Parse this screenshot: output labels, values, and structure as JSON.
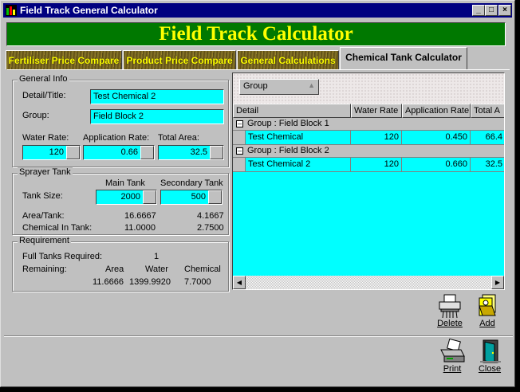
{
  "window": {
    "title": "Field Track General Calculator",
    "minimize": "_",
    "maximize": "□",
    "close": "×"
  },
  "banner": "Field Track Calculator",
  "tabs": [
    "Fertiliser Price Compare",
    "Product Price Compare",
    "General Calculations",
    "Chemical Tank Calculator"
  ],
  "general_info": {
    "title": "General Info",
    "detail_label": "Detail/Title:",
    "detail_value": "Test Chemical 2",
    "group_label": "Group:",
    "group_value": "Field Block 2",
    "water_rate_label": "Water Rate:",
    "water_rate_value": "120",
    "app_rate_label": "Application Rate:",
    "app_rate_value": "0.66",
    "total_area_label": "Total Area:",
    "total_area_value": "32.5"
  },
  "sprayer_tank": {
    "title": "Sprayer Tank",
    "main_tank_label": "Main Tank",
    "secondary_tank_label": "Secondary Tank",
    "tank_size_label": "Tank Size:",
    "main_size": "2000",
    "secondary_size": "500",
    "area_tank_label": "Area/Tank:",
    "area_main": "16.6667",
    "area_secondary": "4.1667",
    "chem_tank_label": "Chemical In Tank:",
    "chem_main": "11.0000",
    "chem_secondary": "2.7500"
  },
  "requirement": {
    "title": "Requirement",
    "full_tanks_label": "Full Tanks Required:",
    "full_tanks_value": "1",
    "remaining_label": "Remaining:",
    "col_area": "Area",
    "col_water": "Water",
    "col_chemical": "Chemical",
    "area_value": "11.6666",
    "water_value": "1399.9920",
    "chemical_value": "7.7000"
  },
  "grid": {
    "group_button": "Group",
    "columns": [
      "Detail",
      "Water Rate",
      "Application Rate",
      "Total A"
    ],
    "groups": [
      {
        "label": "Group : Field Block 1",
        "rows": [
          {
            "detail": "Test Chemical",
            "water": "120",
            "app": "0.450",
            "total": "66.4"
          }
        ]
      },
      {
        "label": "Group : Field Block 2",
        "rows": [
          {
            "detail": "Test Chemical 2",
            "water": "120",
            "app": "0.660",
            "total": "32.5"
          }
        ]
      }
    ]
  },
  "buttons": {
    "delete": "Delete",
    "add": "Add",
    "print": "Print",
    "close": "Close"
  }
}
